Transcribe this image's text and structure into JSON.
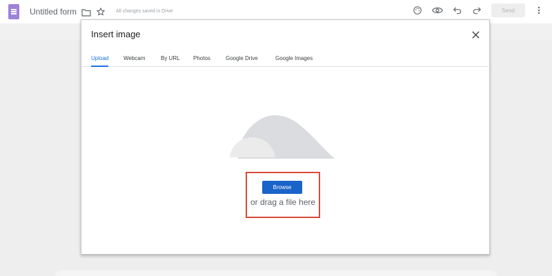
{
  "app": {
    "title": "Untitled form",
    "save_status": "All changes saved in Drive",
    "send_label": "Send"
  },
  "icons": {
    "logo": "forms-logo-icon",
    "folder": "folder-icon",
    "star": "star-icon",
    "palette": "palette-icon",
    "preview": "eye-icon",
    "undo": "undo-icon",
    "redo": "redo-icon",
    "more": "more-vert-icon",
    "close": "close-icon",
    "upload": "cloud-icon"
  },
  "dialog": {
    "title": "Insert image",
    "tabs": [
      {
        "label": "Upload",
        "active": true
      },
      {
        "label": "Webcam",
        "active": false
      },
      {
        "label": "By URL",
        "active": false
      },
      {
        "label": "Photos",
        "active": false
      },
      {
        "label": "Google Drive",
        "active": false
      },
      {
        "label": "Google Images",
        "active": false
      }
    ],
    "browse_label": "Browse",
    "drag_text": "or drag a file here"
  },
  "colors": {
    "accent": "#1a73e8",
    "browse_button": "#1a63c9",
    "highlight": "#d84a38",
    "logo": "#9e82d6"
  }
}
